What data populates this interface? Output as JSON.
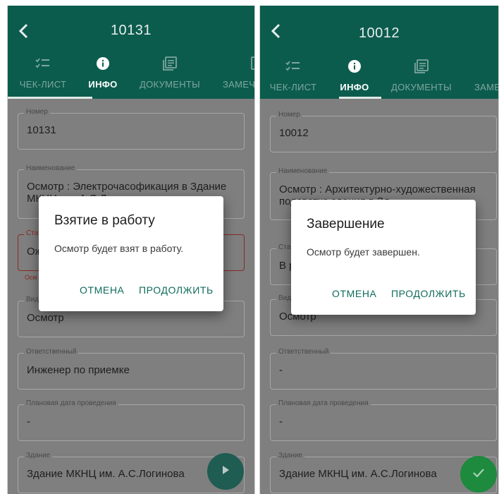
{
  "colors": {
    "appbar": "#0c5c4e",
    "accent": "#0f6b5c",
    "error": "#8a2a22",
    "fab_play": "#1f5c52",
    "fab_done": "#1d8a3e"
  },
  "tabs": {
    "checklist": {
      "label": "ЧЕК-ЛИСТ",
      "icon": "checklist-icon"
    },
    "info": {
      "label": "ИНФО",
      "icon": "info-icon"
    },
    "documents": {
      "label": "ДОКУМЕНТЫ",
      "icon": "documents-icon"
    },
    "remarks": {
      "label": "ЗАМЕЧ",
      "icon": "remarks-icon"
    }
  },
  "screen1": {
    "title": "10131",
    "remarks_tab_label": "ЗАМЕЧ",
    "fields": {
      "number": {
        "label": "Номер",
        "value": "10131"
      },
      "name": {
        "label": "Наименование",
        "value": "Осмотр : Электрочасофикация в Здание МКНЦ им. А.С.Логинова"
      },
      "status": {
        "label": "Ста",
        "value": "Ож"
      },
      "status_error": "Осм",
      "type": {
        "label": "Вид",
        "value": "Осмотр"
      },
      "responsible": {
        "label": "Ответственный",
        "value": "Инженер по приемке"
      },
      "planned_date": {
        "label": "Плановая дата проведения",
        "value": "-"
      },
      "building": {
        "label": "Здание",
        "value": "Здание МКНЦ им. А.С.Логинова"
      }
    },
    "fab_icon": "play-icon",
    "dialog": {
      "title": "Взятие в работу",
      "text": "Осмотр будет взят в работу.",
      "cancel": "ОТМЕНА",
      "confirm": "ПРОДОЛЖИТЬ"
    }
  },
  "screen2": {
    "title": "10012",
    "remarks_tab_label": "ЗАМЕ",
    "fields": {
      "number": {
        "label": "Номер",
        "value": "10012"
      },
      "name": {
        "label": "Наименование",
        "value": "Осмотр : Архитектурно-художественная подсветка здания в Зд"
      },
      "status": {
        "label": "Ста",
        "value": "В р"
      },
      "type": {
        "label": "Вид",
        "value": "Осмотр"
      },
      "responsible": {
        "label": "Ответственный",
        "value": "-"
      },
      "planned_date": {
        "label": "Плановая дата проведения",
        "value": "-"
      },
      "building": {
        "label": "Здание",
        "value": "Здание МКНЦ им. А.С.Логинова"
      }
    },
    "fab_icon": "check-icon",
    "dialog": {
      "title": "Завершение",
      "text": "Осмотр будет завершен.",
      "cancel": "ОТМЕНА",
      "confirm": "ПРОДОЛЖИТЬ"
    }
  }
}
